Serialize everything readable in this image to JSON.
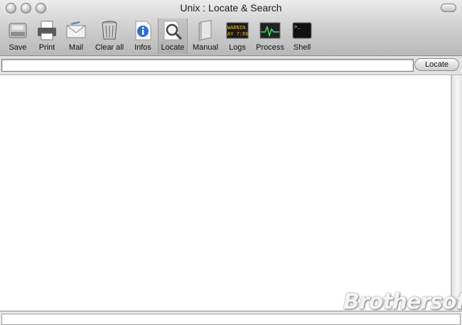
{
  "window": {
    "title": "Unix : Locate & Search"
  },
  "toolbar": {
    "items": [
      {
        "id": "save",
        "label": "Save",
        "icon": "disk-icon"
      },
      {
        "id": "print",
        "label": "Print",
        "icon": "printer-icon"
      },
      {
        "id": "mail",
        "label": "Mail",
        "icon": "mail-icon"
      },
      {
        "id": "clear",
        "label": "Clear all",
        "icon": "trash-icon"
      },
      {
        "id": "infos",
        "label": "Infos",
        "icon": "info-icon"
      },
      {
        "id": "locate",
        "label": "Locate",
        "icon": "magnifier-icon",
        "active": true
      },
      {
        "id": "manual",
        "label": "Manual",
        "icon": "book-icon"
      },
      {
        "id": "logs",
        "label": "Logs",
        "icon": "console-log-icon",
        "icon_text": [
          "WARNIN",
          "AY 7:86"
        ]
      },
      {
        "id": "process",
        "label": "Process",
        "icon": "activity-monitor-icon"
      },
      {
        "id": "shell",
        "label": "Shell",
        "icon": "terminal-icon",
        "icon_text": ">_"
      }
    ]
  },
  "search": {
    "value": "",
    "button_label": "Locate"
  },
  "watermark": {
    "text": "Brothersoft"
  },
  "colors": {
    "titlebar_top": "#ececec",
    "titlebar_bottom": "#b8b8b8",
    "logs_text": "#f0c030",
    "process_trace": "#3ddc6a"
  }
}
